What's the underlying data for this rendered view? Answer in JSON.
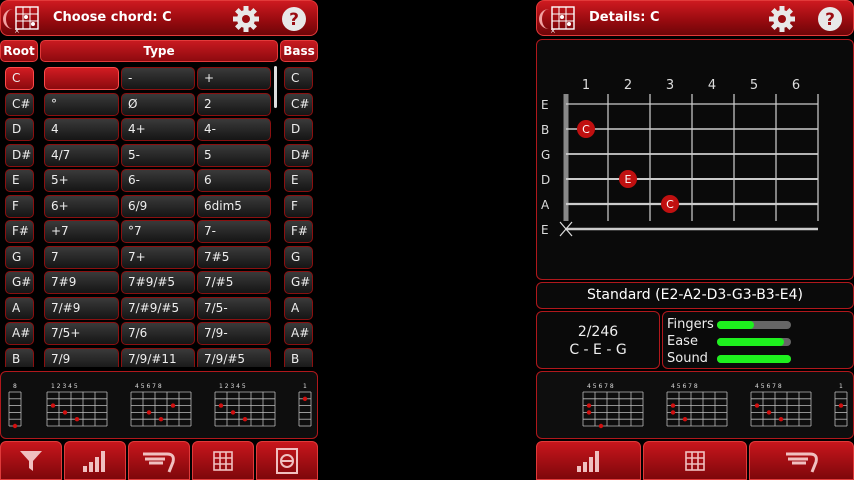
{
  "left": {
    "title": "Choose chord: C",
    "headers": {
      "root": "Root",
      "type": "Type",
      "bass": "Bass"
    },
    "roots": [
      "C",
      "C#",
      "D",
      "D#",
      "E",
      "F",
      "F#",
      "G",
      "G#",
      "A",
      "A#",
      "B"
    ],
    "bass": [
      "C",
      "C#",
      "D",
      "D#",
      "E",
      "F",
      "F#",
      "G",
      "G#",
      "A",
      "A#",
      "B"
    ],
    "type_rows": [
      [
        "",
        "-",
        "+"
      ],
      [
        "°",
        "Ø",
        "2"
      ],
      [
        "4",
        "4+",
        "4-"
      ],
      [
        "4/7",
        "5-",
        "5"
      ],
      [
        "5+",
        "6-",
        "6"
      ],
      [
        "6+",
        "6/9",
        "6dim5"
      ],
      [
        "+7",
        "°7",
        "7-"
      ],
      [
        "7",
        "7+",
        "7#5"
      ],
      [
        "7#9",
        "7#9/#5",
        "7/#5"
      ],
      [
        "7/#9",
        "7/#9/#5",
        "7/5-"
      ],
      [
        "7/5+",
        "7/6",
        "7/9-"
      ],
      [
        "7/9",
        "7/9/#11",
        "7/9/#5"
      ]
    ],
    "selected_root": "C",
    "selected_bass": "C",
    "strip_frets": [
      {
        "labels": "8"
      },
      {
        "labels": "1 2 3 4 5"
      },
      {
        "labels": "4 5 6 7 8"
      },
      {
        "labels": "1 2 3 4 5"
      },
      {
        "labels": "1"
      }
    ],
    "bottom_buttons": [
      "filter-icon",
      "signal-bars-icon",
      "capo-icon",
      "grid-icon",
      "scan-icon"
    ]
  },
  "right": {
    "title": "Details: C",
    "fret_numbers": [
      "1",
      "2",
      "3",
      "4",
      "5",
      "6"
    ],
    "strings": [
      "E",
      "B",
      "G",
      "D",
      "A",
      "E"
    ],
    "notes": [
      {
        "string": 2,
        "fret": 1,
        "label": "C"
      },
      {
        "string": 4,
        "fret": 2,
        "label": "E"
      },
      {
        "string": 5,
        "fret": 3,
        "label": "C"
      }
    ],
    "muted_string": 6,
    "tuning": "Standard (E2-A2-D3-G3-B3-E4)",
    "position": "2/246",
    "notes_text": "C - E - G",
    "ratings": [
      {
        "label": "Fingers",
        "value": 0.5
      },
      {
        "label": "Ease",
        "value": 0.9
      },
      {
        "label": "Sound",
        "value": 1.0
      }
    ],
    "strip_frets": [
      {
        "labels": "4 5 6 7 8"
      },
      {
        "labels": "4 5 6 7 8"
      },
      {
        "labels": "4 5 6 7 8"
      },
      {
        "labels": "1"
      }
    ],
    "bottom_buttons": [
      "signal-bars-icon",
      "grid-icon",
      "capo-icon"
    ]
  },
  "colors": {
    "accent": "#c8161c",
    "green": "#1ef01e",
    "note": "#c01010"
  }
}
